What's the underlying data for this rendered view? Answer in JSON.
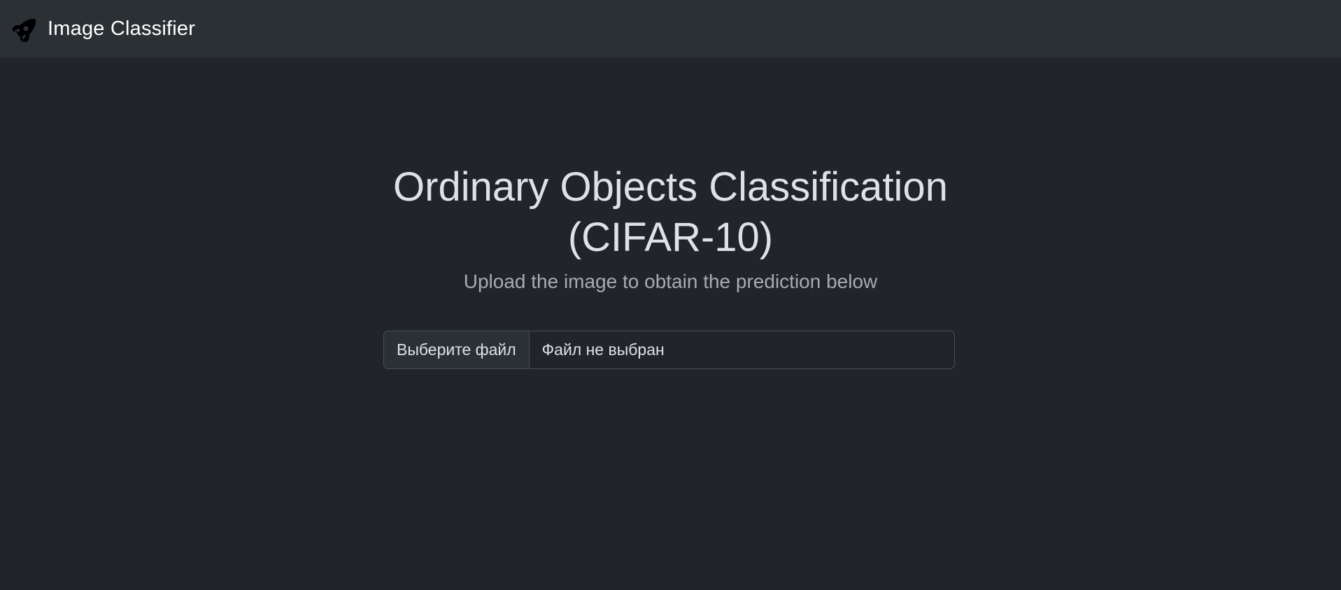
{
  "navbar": {
    "brand_text": "Image Classifier",
    "brand_icon": "rocket-icon"
  },
  "main": {
    "title_line1": "Ordinary Objects Classification",
    "title_line2": "(CIFAR-10)",
    "subtitle": "Upload the image to obtain the prediction below"
  },
  "upload": {
    "button_label": "Выберите файл",
    "status_text": "Файл не выбран"
  },
  "colors": {
    "background": "#212529",
    "navbar": "#2b3035",
    "text": "#dee2e6",
    "muted": "#a7acb1",
    "border": "#495057"
  }
}
